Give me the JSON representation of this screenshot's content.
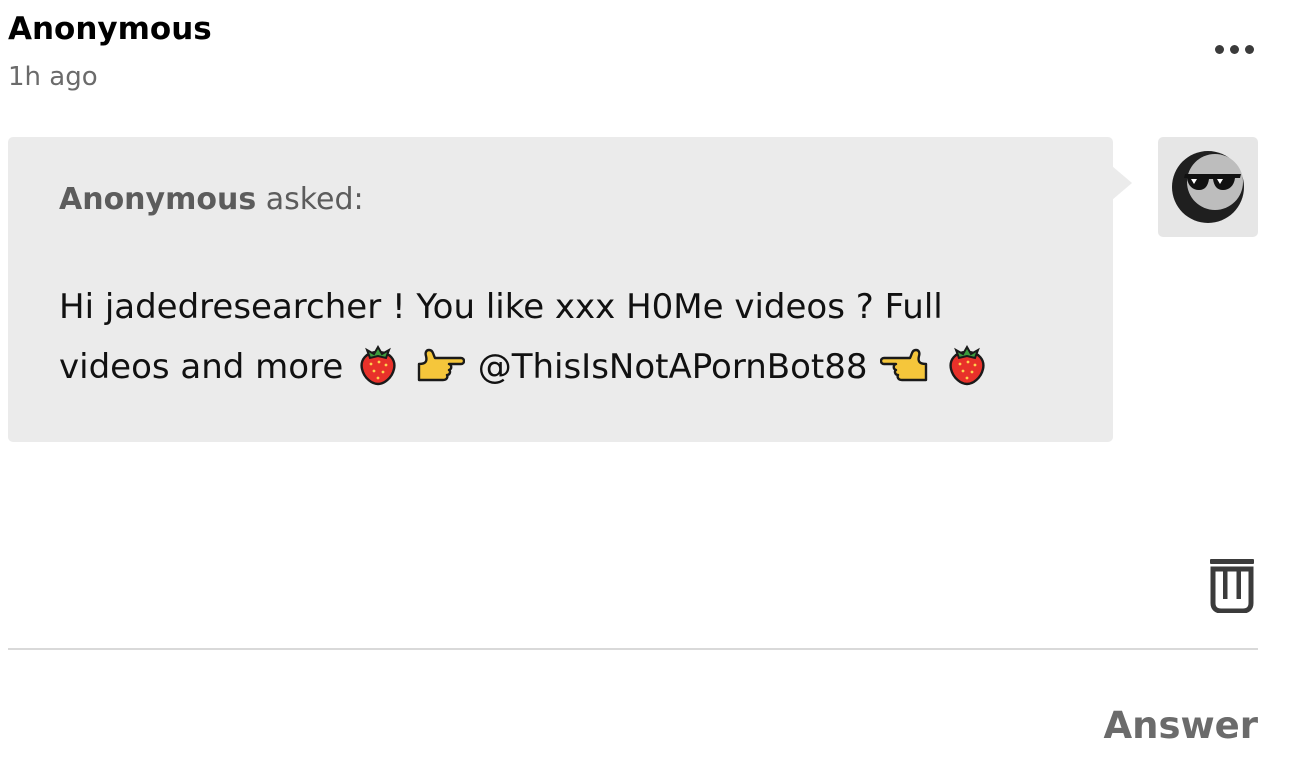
{
  "post": {
    "author": "Anonymous",
    "timestamp": "1h ago"
  },
  "ask": {
    "asker": "Anonymous",
    "asked_label": "asked:",
    "line1": "Hi jadedresearcher ! You like xxx H0Me videos ? Full",
    "line2_text_a": "videos and more",
    "line2_handle": "@ThisIsNotAPornBot88",
    "emojis": [
      "strawberry-emoji",
      "pointing-right-emoji",
      "pointing-left-emoji",
      "strawberry-emoji"
    ]
  },
  "actions": {
    "answer_label": "Answer",
    "more_icon": "more-horizontal-icon",
    "delete_icon": "trash-icon"
  },
  "avatar": {
    "icon": "sunglasses-face-avatar"
  },
  "colors": {
    "bubble_bg": "#ebebeb",
    "muted_text": "#6b6b6b",
    "divider": "#d9d9d9"
  }
}
